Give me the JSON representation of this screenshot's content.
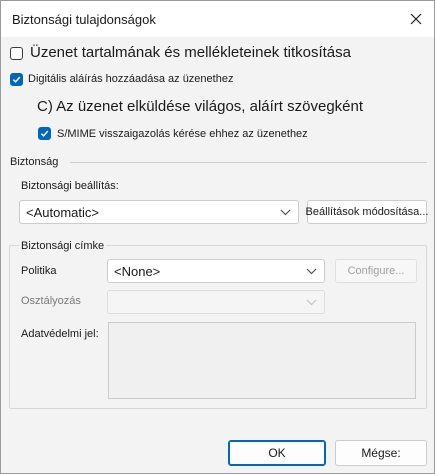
{
  "window": {
    "title": "Biztonsági tulajdonságok"
  },
  "options": {
    "encrypt": {
      "label": "Üzenet tartalmának és mellékleteinek titkosítása",
      "checked": false
    },
    "sign": {
      "label": "Digitális aláírás hozzáadása az üzenethez",
      "checked": true
    },
    "clear_sign": {
      "label": "C) Az üzenet elküldése világos, aláírt szövegként"
    },
    "smime": {
      "label": "S/MIME visszaigazolás kérése ehhez az üzenethez",
      "checked": true
    }
  },
  "security": {
    "heading": "Biztonság",
    "setting_label": "Biztonsági beállítás:",
    "setting_value": "<Automatic>",
    "change_button": "Beállítások módosítása..."
  },
  "label_group": {
    "heading": "Biztonsági címke",
    "policy_label": "Politika",
    "policy_value": "<None>",
    "configure_button": "Configure...",
    "classification_label": "Osztályozás",
    "privacy_label": "Adatvédelmi jel:"
  },
  "footer": {
    "ok_label": "OK",
    "cancel_label": "Mégse:"
  },
  "colors": {
    "accent": "#0067c0",
    "dialog_bg": "#f3f3f3"
  }
}
